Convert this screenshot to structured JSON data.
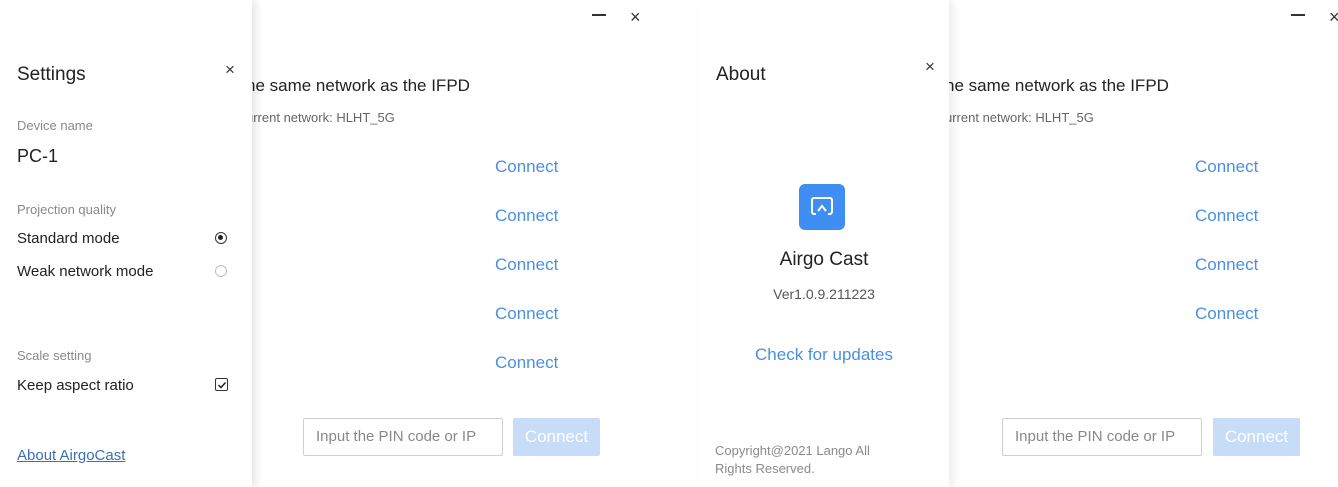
{
  "colors": {
    "accent": "#4a90e2",
    "disabled_button": "#c6dcf7",
    "icon_blue": "#3f8ef3"
  },
  "window": {
    "minimize_symbol": "–",
    "close_symbol": "×",
    "gear_icon": "gear-icon"
  },
  "main": {
    "network_title": "ne same network as the IFPD",
    "network_sub": "urrent network: HLHT_5G",
    "connect_label": "Connect",
    "connect_links": [
      "Connect",
      "Connect",
      "Connect",
      "Connect",
      "Connect"
    ],
    "pin_placeholder": "Input the PIN code or IP",
    "pin_button": "Connect"
  },
  "settings_panel": {
    "title": "Settings",
    "close_symbol": "×",
    "device_name_label": "Device name",
    "device_name": "PC-1",
    "projection_quality_label": "Projection quality",
    "standard_mode": "Standard mode",
    "weak_network_mode": "Weak network mode",
    "selected_mode": "Standard mode",
    "scale_setting_label": "Scale setting",
    "keep_aspect_ratio": "Keep aspect ratio",
    "keep_aspect_ratio_checked": true,
    "about_link": "About AirgoCast"
  },
  "about_panel": {
    "title": "About",
    "close_symbol": "×",
    "app_name": "Airgo Cast",
    "version": "Ver1.0.9.211223",
    "check_updates": "Check for updates",
    "copyright_line1": "Copyright@2021 Lango All",
    "copyright_line2": "Rights Reserved."
  }
}
